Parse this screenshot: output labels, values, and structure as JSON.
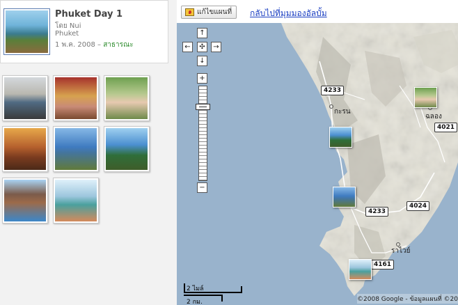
{
  "album": {
    "title": "Phuket Day 1",
    "owner": "โดย Nui",
    "location": "Phuket",
    "date": "1 พ.ค. 2008",
    "separator": "–",
    "visibility": "สาธารณะ"
  },
  "thumbnails": [
    {
      "id": "photo-1"
    },
    {
      "id": "photo-2"
    },
    {
      "id": "photo-3"
    },
    {
      "id": "photo-4"
    },
    {
      "id": "photo-5"
    },
    {
      "id": "photo-6"
    },
    {
      "id": "photo-7"
    },
    {
      "id": "photo-8"
    }
  ],
  "toolbar": {
    "edit_map_label": "แก้ไขแผนที่",
    "back_to_album_label": "กลับไปที่มุมมองอัลบั้ม"
  },
  "map": {
    "pan": {
      "up": "↑",
      "down": "↓",
      "left": "←",
      "right": "→",
      "center": "✣"
    },
    "zoom": {
      "in": "+",
      "out": "−"
    },
    "routes": [
      "4233",
      "4021",
      "4233",
      "4024",
      "4161"
    ],
    "places": {
      "kathu": "กะรน",
      "chalong": "ฉลอง",
      "rawai": "ราไวย์"
    },
    "scale": {
      "top": "2 ไมล์",
      "bottom": "2 กม."
    },
    "copyright": "©2008 Google - ข้อมูลแผนที่ ©20",
    "colors": {
      "sea": "#99b3cc",
      "land": "#e5e3d8",
      "terrain": "#c9c7bb"
    }
  }
}
